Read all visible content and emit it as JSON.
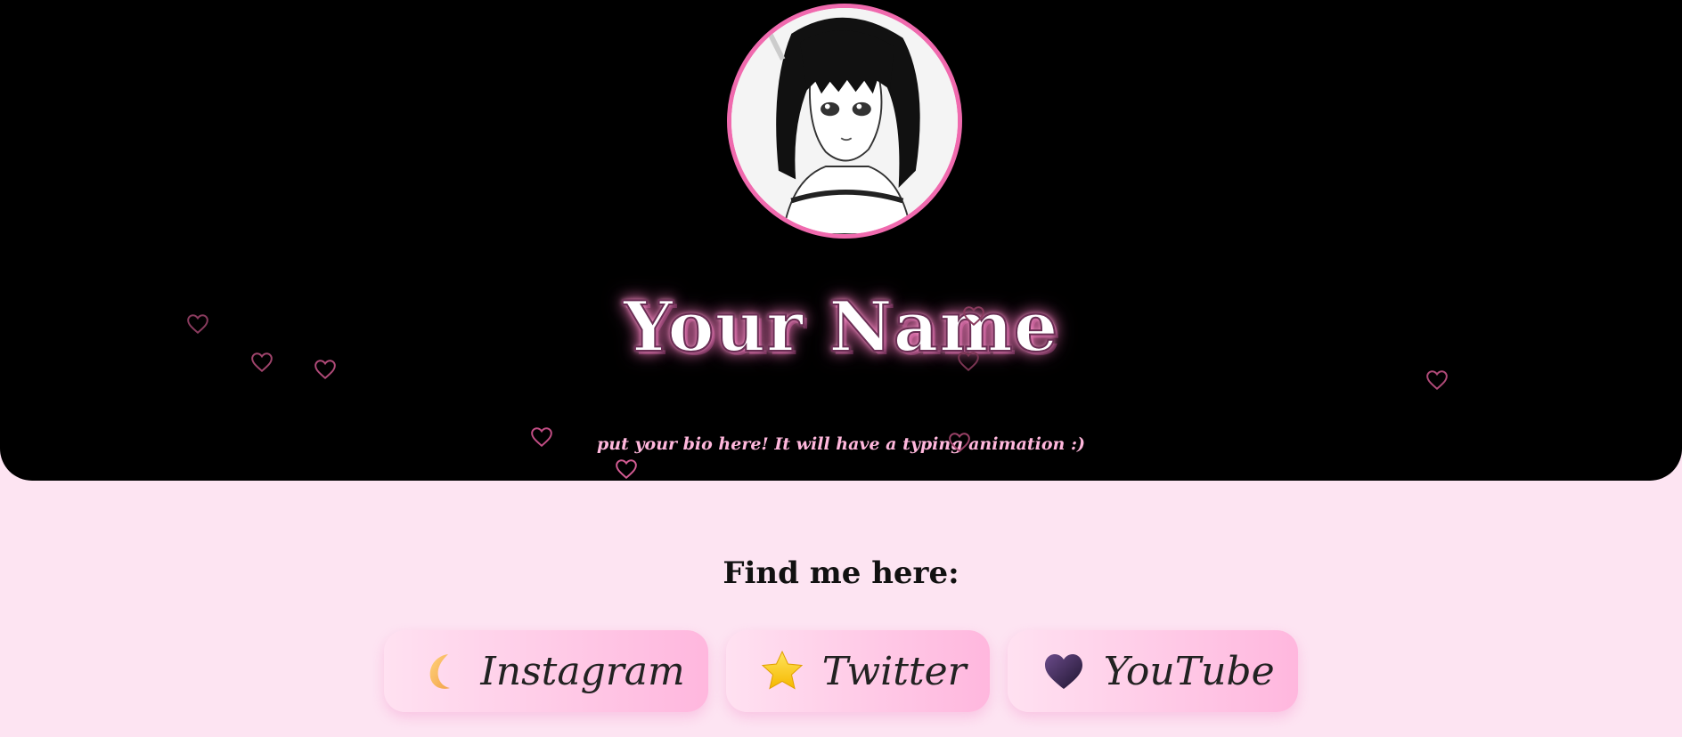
{
  "profile": {
    "name": "Your Name",
    "bio": "put your bio here! It will have a typing animation :)"
  },
  "links_section": {
    "heading": "Find me here:",
    "links": [
      {
        "label": "Instagram",
        "icon": "crescent-moon-icon"
      },
      {
        "label": "Twitter",
        "icon": "star-icon"
      },
      {
        "label": "YouTube",
        "icon": "black-heart-icon"
      }
    ]
  },
  "colors": {
    "hero_background": "#000000",
    "page_background": "#fde4f2",
    "avatar_border": "#f06aae",
    "bio_text": "#ffb7dc",
    "heart_outline": "#c24d84",
    "button_gradient_start": "#ffe1f1",
    "button_gradient_end": "#ffb7de"
  }
}
